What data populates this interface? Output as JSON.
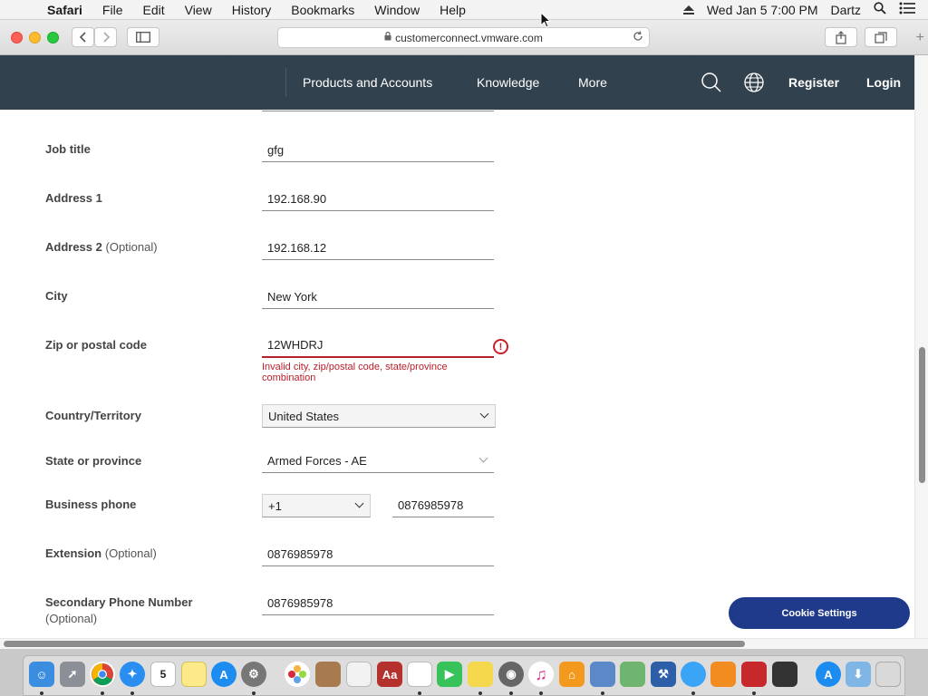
{
  "menubar": {
    "app": "Safari",
    "menus": [
      "File",
      "Edit",
      "View",
      "History",
      "Bookmarks",
      "Window",
      "Help"
    ],
    "clock": "Wed Jan 5  7:00 PM",
    "user": "Dartz"
  },
  "browser": {
    "url": "customerconnect.vmware.com"
  },
  "site_header": {
    "nav": [
      "Products and Accounts",
      "Knowledge",
      "More"
    ],
    "register": "Register",
    "login": "Login"
  },
  "form": {
    "job_title": {
      "label": "Job title",
      "value": "gfg"
    },
    "address1": {
      "label": "Address 1",
      "value": "192.168.90"
    },
    "address2": {
      "label": "Address 2",
      "optional": "(Optional)",
      "value": "192.168.12"
    },
    "city": {
      "label": "City",
      "value": "New York"
    },
    "zip": {
      "label": "Zip or postal code",
      "value": "12WHDRJ",
      "error": "Invalid city, zip/postal code, state/province combination"
    },
    "country": {
      "label": "Country/Territory",
      "value": "United States"
    },
    "state": {
      "label": "State or province",
      "value": "Armed Forces - AE"
    },
    "business_phone": {
      "label": "Business phone",
      "code": "+1",
      "value": "0876985978"
    },
    "extension": {
      "label": "Extension",
      "optional": "(Optional)",
      "value": "0876985978"
    },
    "secondary_phone": {
      "label": "Secondary Phone Number",
      "optional": "(Optional)",
      "value": "0876985978"
    }
  },
  "cookie_button": "Cookie Settings",
  "dock": {
    "calendar_day": "5",
    "apps": [
      "finder-icon",
      "launchpad-icon",
      "chrome-icon",
      "safari-icon",
      "calendar-icon",
      "notes-icon",
      "app-store-icon",
      "system-preferences-icon",
      "photos-icon",
      "contacts-icon",
      "textedit-icon",
      "dictionary-icon",
      "reminders-icon",
      "facetime-icon",
      "stickies-icon",
      "screenshot-icon",
      "itunes-icon",
      "home-icon",
      "preview-icon",
      "maps-icon",
      "xcode-icon",
      "messages-icon",
      "books-icon",
      "photo-booth-icon",
      "notebook-icon",
      "app-store-icon-2",
      "downloads-folder-icon",
      "trash-icon"
    ]
  }
}
